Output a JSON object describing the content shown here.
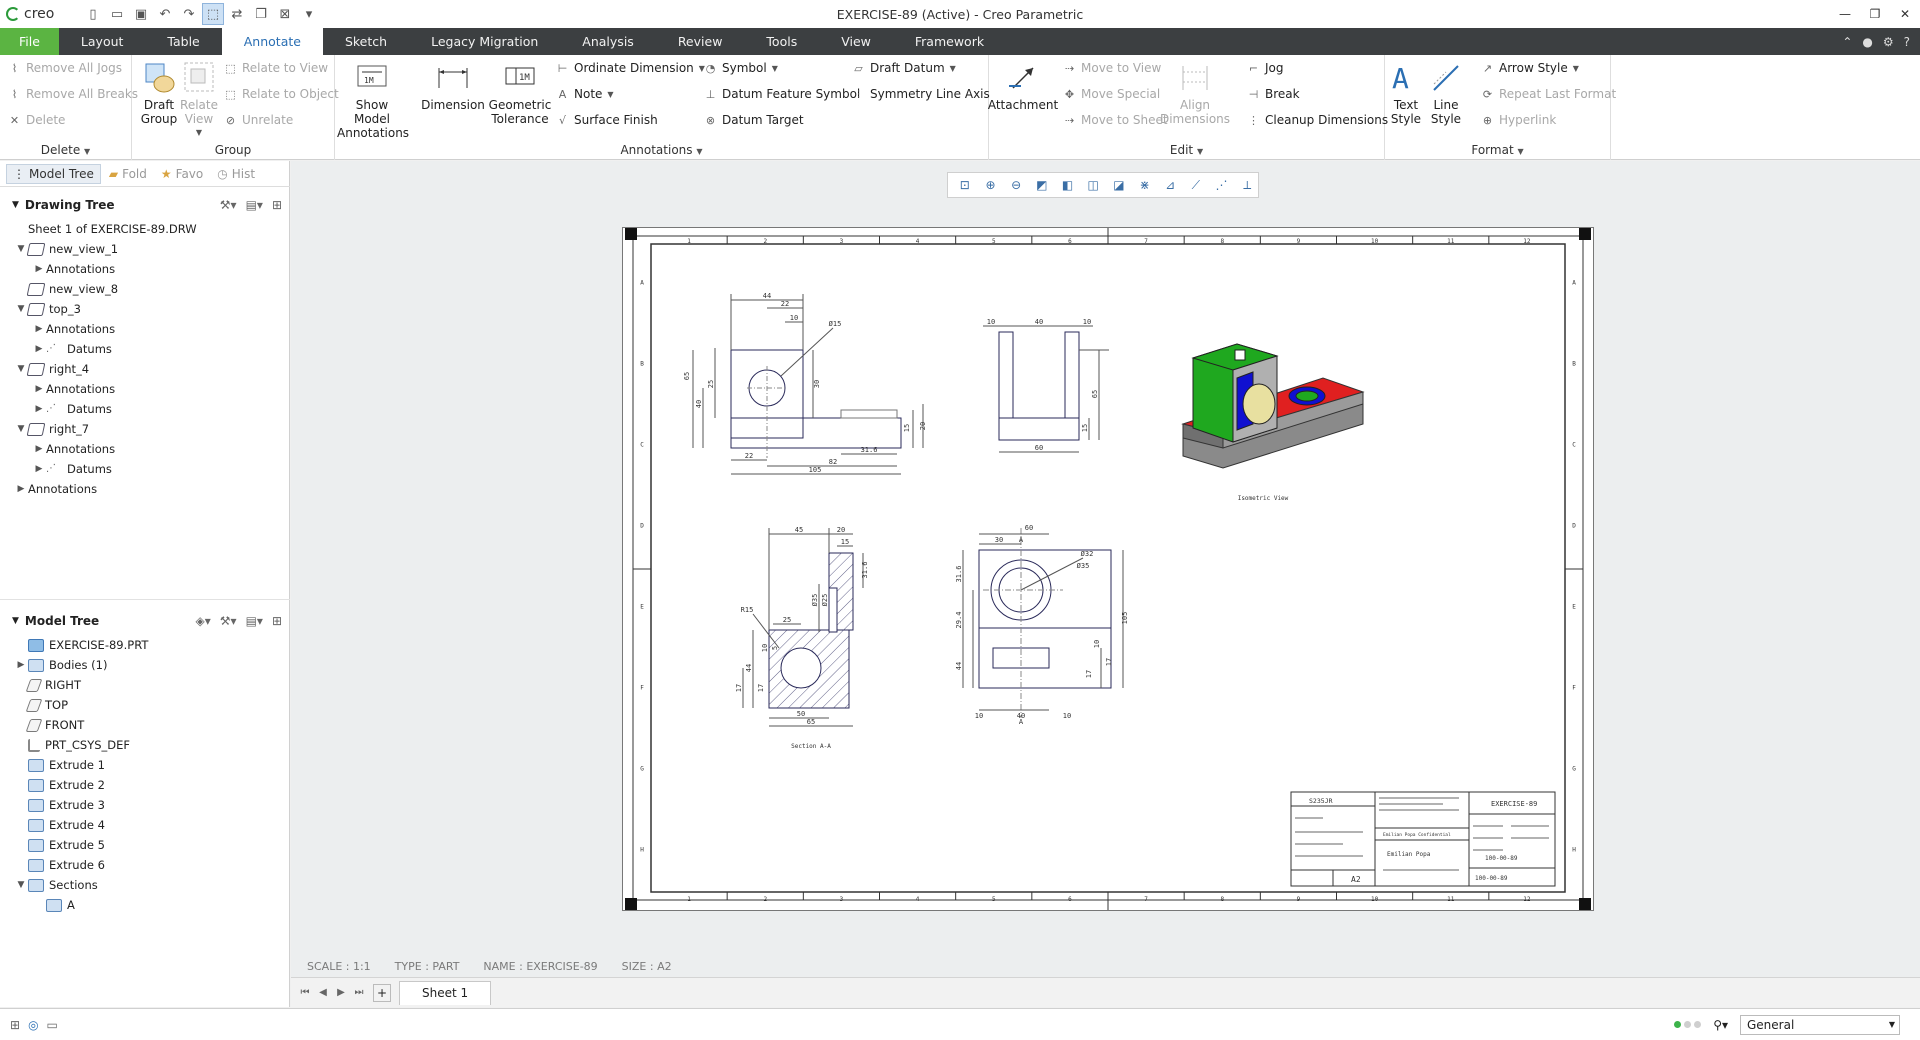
{
  "app": {
    "logo": "creo",
    "window_title": "EXERCISE-89 (Active) - Creo Parametric"
  },
  "tabs": [
    "File",
    "Layout",
    "Table",
    "Annotate",
    "Sketch",
    "Legacy Migration",
    "Analysis",
    "Review",
    "Tools",
    "View",
    "Framework"
  ],
  "ribbon": {
    "delete_group": {
      "remove_all_jogs": "Remove All Jogs",
      "remove_all_breaks": "Remove All Breaks",
      "delete": "Delete",
      "label": "Delete"
    },
    "group_group": {
      "draft_group": "Draft Group",
      "relate_view": "Relate View",
      "relate_to_view": "Relate to View",
      "relate_to_object": "Relate to Object",
      "unrelate": "Unrelate",
      "label": "Group"
    },
    "annotations_group": {
      "show_model_annotations": "Show Model Annotations",
      "dimension": "Dimension",
      "geometric_tolerance": "Geometric Tolerance",
      "ordinate_dimension": "Ordinate Dimension",
      "note": "Note",
      "surface_finish": "Surface Finish",
      "symbol": "Symbol",
      "datum_feature_symbol": "Datum Feature Symbol",
      "datum_target": "Datum Target",
      "draft_datum": "Draft Datum",
      "symmetry_line_axis": "Symmetry Line Axis",
      "label": "Annotations"
    },
    "edit_group": {
      "attachment": "Attachment",
      "move_to_view": "Move to View",
      "move_special": "Move Special",
      "move_to_sheet": "Move to Sheet",
      "align_dimensions": "Align Dimensions",
      "jog": "Jog",
      "break": "Break",
      "cleanup_dimensions": "Cleanup Dimensions",
      "label": "Edit"
    },
    "format_group": {
      "text_style": "Text Style",
      "line_style": "Line Style",
      "arrow_style": "Arrow Style",
      "repeat_last_format": "Repeat Last Format",
      "hyperlink": "Hyperlink",
      "label": "Format"
    }
  },
  "panel_tabs": [
    "Model Tree",
    "Fold",
    "Favo",
    "Hist"
  ],
  "drawing_tree": {
    "title": "Drawing Tree",
    "items": [
      {
        "label": "Sheet 1 of EXERCISE-89.DRW",
        "level": 0,
        "toggle": "",
        "icon": "sheet"
      },
      {
        "label": "new_view_1",
        "level": 0,
        "toggle": "▼",
        "icon": "view"
      },
      {
        "label": "Annotations",
        "level": 1,
        "toggle": "▶",
        "icon": "none"
      },
      {
        "label": "new_view_8",
        "level": 0,
        "toggle": "",
        "icon": "view"
      },
      {
        "label": "top_3",
        "level": 0,
        "toggle": "▼",
        "icon": "view"
      },
      {
        "label": "Annotations",
        "level": 1,
        "toggle": "▶",
        "icon": "none"
      },
      {
        "label": "Datums",
        "level": 1,
        "toggle": "▶",
        "icon": "datum"
      },
      {
        "label": "right_4",
        "level": 0,
        "toggle": "▼",
        "icon": "view"
      },
      {
        "label": "Annotations",
        "level": 1,
        "toggle": "▶",
        "icon": "none"
      },
      {
        "label": "Datums",
        "level": 1,
        "toggle": "▶",
        "icon": "datum"
      },
      {
        "label": "right_7",
        "level": 0,
        "toggle": "▼",
        "icon": "view"
      },
      {
        "label": "Annotations",
        "level": 1,
        "toggle": "▶",
        "icon": "none"
      },
      {
        "label": "Datums",
        "level": 1,
        "toggle": "▶",
        "icon": "datum"
      },
      {
        "label": "Annotations",
        "level": 0,
        "toggle": "▶",
        "icon": "none"
      }
    ]
  },
  "model_tree": {
    "title": "Model Tree",
    "items": [
      {
        "label": "EXERCISE-89.PRT",
        "level": 0,
        "toggle": "",
        "icon": "part"
      },
      {
        "label": "Bodies (1)",
        "level": 0,
        "toggle": "▶",
        "icon": "feat"
      },
      {
        "label": "RIGHT",
        "level": 0,
        "toggle": "",
        "icon": "plane"
      },
      {
        "label": "TOP",
        "level": 0,
        "toggle": "",
        "icon": "plane"
      },
      {
        "label": "FRONT",
        "level": 0,
        "toggle": "",
        "icon": "plane"
      },
      {
        "label": "PRT_CSYS_DEF",
        "level": 0,
        "toggle": "",
        "icon": "csys"
      },
      {
        "label": "Extrude 1",
        "level": 0,
        "toggle": "",
        "icon": "feat"
      },
      {
        "label": "Extrude 2",
        "level": 0,
        "toggle": "",
        "icon": "feat"
      },
      {
        "label": "Extrude 3",
        "level": 0,
        "toggle": "",
        "icon": "feat"
      },
      {
        "label": "Extrude 4",
        "level": 0,
        "toggle": "",
        "icon": "feat"
      },
      {
        "label": "Extrude 5",
        "level": 0,
        "toggle": "",
        "icon": "feat"
      },
      {
        "label": "Extrude 6",
        "level": 0,
        "toggle": "",
        "icon": "feat"
      },
      {
        "label": "Sections",
        "level": 0,
        "toggle": "▼",
        "icon": "feat"
      },
      {
        "label": "A",
        "level": 1,
        "toggle": "",
        "icon": "feat"
      }
    ]
  },
  "drawing": {
    "isometric_label": "Isometric View",
    "section_label": "Section A-A",
    "title_block": {
      "code": "S235JR",
      "name": "EXERCISE-89",
      "size": "A2",
      "company": "Emilian Popa",
      "confidential": "Emilian Popa Confidential",
      "number1": "100-00-89",
      "number2": "100-00-89"
    },
    "zone_numbers": [
      "1",
      "2",
      "3",
      "4",
      "5",
      "6",
      "7",
      "8",
      "9",
      "10",
      "11",
      "12"
    ],
    "zone_letters": [
      "A",
      "B",
      "C",
      "D",
      "E",
      "F",
      "G",
      "H"
    ],
    "front_dims": [
      "44",
      "22",
      "10",
      "Ø15",
      "65",
      "40",
      "25",
      "30",
      "15",
      "20",
      "22",
      "82",
      "31.6",
      "105"
    ],
    "right_dims": [
      "10",
      "40",
      "10",
      "65",
      "15",
      "60"
    ],
    "section_dims": [
      "45",
      "20",
      "15",
      "31.6",
      "Ø35",
      "Ø25",
      "R15",
      "25",
      "44",
      "17",
      "10",
      "5",
      "17",
      "50",
      "65"
    ],
    "top_dims": [
      "60",
      "30",
      "A",
      "Ø32",
      "Ø35",
      "31.6",
      "29.4",
      "44",
      "105",
      "10",
      "17",
      "17",
      "10",
      "40",
      "10",
      "A"
    ]
  },
  "info": {
    "scale": "SCALE : 1:1",
    "type": "TYPE : PART",
    "name": "NAME : EXERCISE-89",
    "size": "SIZE : A2"
  },
  "sheet_tab": "Sheet 1",
  "status": {
    "filter": "General"
  },
  "colors": {
    "file_tab": "#5bb442",
    "tabbar": "#3c3f41",
    "active_tab_text": "#2b6fb3",
    "iso_green": "#1fa81f",
    "iso_red": "#e02020",
    "iso_blue": "#1010d0",
    "iso_yellow": "#e8e0a0"
  }
}
